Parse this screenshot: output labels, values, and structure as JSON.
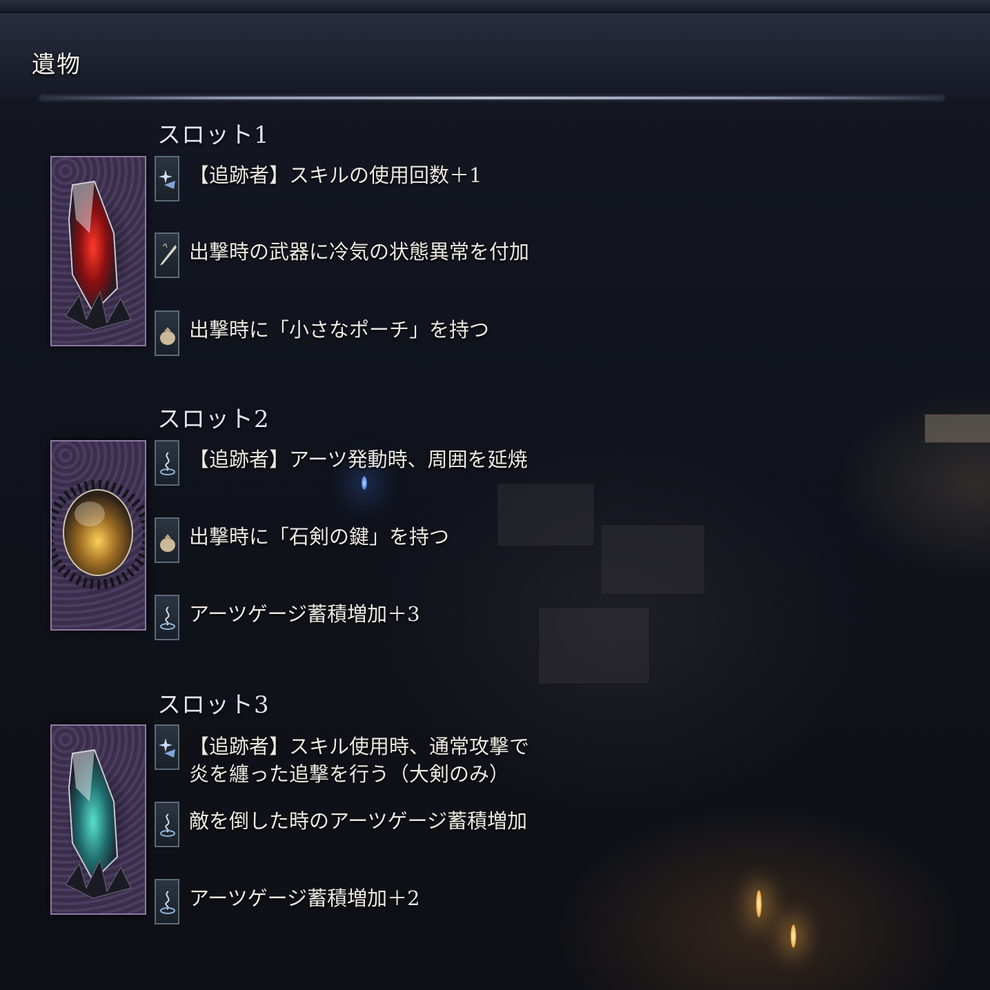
{
  "page": {
    "title": "遺物"
  },
  "slots": [
    {
      "title": "スロット1",
      "relic_color": "#d0231c",
      "effects": [
        {
          "icon": "skill-star-icon",
          "text": "【追跡者】スキルの使用回数＋1"
        },
        {
          "icon": "sword-icon",
          "text": "出撃時の武器に冷気の状態異常を付加"
        },
        {
          "icon": "pouch-icon",
          "text": "出撃時に「小さなポーチ」を持つ"
        }
      ]
    },
    {
      "title": "スロット2",
      "relic_color": "#d9a22a",
      "effects": [
        {
          "icon": "arts-swirl-icon",
          "text": "【追跡者】アーツ発動時、周囲を延焼"
        },
        {
          "icon": "pouch-icon",
          "text": "出撃時に「石剣の鍵」を持つ"
        },
        {
          "icon": "arts-swirl-icon",
          "text": "アーツゲージ蓄積増加＋3"
        }
      ]
    },
    {
      "title": "スロット3",
      "relic_color": "#3fb3a6",
      "effects": [
        {
          "icon": "skill-star-icon",
          "text": "【追跡者】スキル使用時、通常攻撃で",
          "text2": "炎を纏った追撃を行う（大剣のみ）"
        },
        {
          "icon": "arts-swirl-icon",
          "text": "敵を倒した時のアーツゲージ蓄積増加"
        },
        {
          "icon": "arts-swirl-icon",
          "text": "アーツゲージ蓄積増加＋2"
        }
      ]
    }
  ]
}
